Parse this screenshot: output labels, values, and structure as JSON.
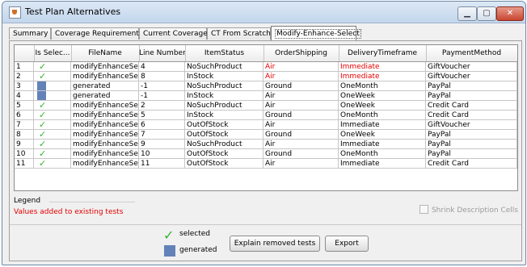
{
  "window": {
    "title": "Test Plan Alternatives",
    "controls": {
      "min": "▁",
      "max": "▢",
      "close": "✕"
    }
  },
  "tabs": [
    {
      "label": "Summary",
      "active": false
    },
    {
      "label": "Coverage Requirements",
      "active": false
    },
    {
      "label": "Current Coverage",
      "active": false
    },
    {
      "label": "CT From Scratch",
      "active": false
    },
    {
      "label": "Modify-Enhance-Select",
      "active": true
    }
  ],
  "table": {
    "columns": [
      "",
      "Is Selec...",
      "FileName",
      "Line Number",
      "ItemStatus",
      "OrderShipping",
      "DeliveryTimeframe",
      "PaymentMethod"
    ],
    "rows": [
      {
        "id": "1",
        "status": "selected",
        "file": "modifyEnhanceSe...",
        "line": "4",
        "item": "NoSuchProduct",
        "ship": "Air",
        "ship_red": true,
        "delivery": "Immediate",
        "delivery_red": true,
        "pay": "GiftVoucher",
        "pay_red": false
      },
      {
        "id": "2",
        "status": "selected",
        "file": "modifyEnhanceSe...",
        "line": "8",
        "item": "InStock",
        "ship": "Air",
        "ship_red": true,
        "delivery": "Immediate",
        "delivery_red": true,
        "pay": "GiftVoucher",
        "pay_red": false
      },
      {
        "id": "3",
        "status": "generated",
        "file": "generated",
        "line": "-1",
        "item": "NoSuchProduct",
        "ship": "Ground",
        "ship_red": false,
        "delivery": "OneMonth",
        "delivery_red": false,
        "pay": "PayPal",
        "pay_red": false
      },
      {
        "id": "4",
        "status": "generated",
        "file": "generated",
        "line": "-1",
        "item": "InStock",
        "ship": "Air",
        "ship_red": false,
        "delivery": "OneWeek",
        "delivery_red": false,
        "pay": "PayPal",
        "pay_red": false
      },
      {
        "id": "5",
        "status": "selected",
        "file": "modifyEnhanceSe...",
        "line": "2",
        "item": "NoSuchProduct",
        "ship": "Air",
        "ship_red": false,
        "delivery": "OneWeek",
        "delivery_red": false,
        "pay": "Credit Card",
        "pay_red": false
      },
      {
        "id": "6",
        "status": "selected",
        "file": "modifyEnhanceSe...",
        "line": "5",
        "item": "InStock",
        "ship": "Ground",
        "ship_red": false,
        "delivery": "OneMonth",
        "delivery_red": false,
        "pay": "Credit Card",
        "pay_red": false
      },
      {
        "id": "7",
        "status": "selected",
        "file": "modifyEnhanceSe...",
        "line": "6",
        "item": "OutOfStock",
        "ship": "Air",
        "ship_red": false,
        "delivery": "Immediate",
        "delivery_red": false,
        "pay": "GiftVoucher",
        "pay_red": false
      },
      {
        "id": "8",
        "status": "selected",
        "file": "modifyEnhanceSe...",
        "line": "7",
        "item": "OutOfStock",
        "ship": "Ground",
        "ship_red": false,
        "delivery": "OneWeek",
        "delivery_red": false,
        "pay": "PayPal",
        "pay_red": false
      },
      {
        "id": "9",
        "status": "selected",
        "file": "modifyEnhanceSe...",
        "line": "9",
        "item": "NoSuchProduct",
        "ship": "Air",
        "ship_red": false,
        "delivery": "Immediate",
        "delivery_red": false,
        "pay": "PayPal",
        "pay_red": false
      },
      {
        "id": "10",
        "status": "selected",
        "file": "modifyEnhanceSe...",
        "line": "10",
        "item": "OutOfStock",
        "ship": "Ground",
        "ship_red": false,
        "delivery": "OneMonth",
        "delivery_red": false,
        "pay": "PayPal",
        "pay_red": false
      },
      {
        "id": "11",
        "status": "selected",
        "file": "modifyEnhanceSe...",
        "line": "11",
        "item": "OutOfStock",
        "ship": "Air",
        "ship_red": false,
        "delivery": "Immediate",
        "delivery_red": false,
        "pay": "Credit Card",
        "pay_red": false
      }
    ]
  },
  "legend": {
    "title": "Legend",
    "note": "Values added to existing tests"
  },
  "shrink": {
    "label": "Shrink Description Cells",
    "checked": false
  },
  "key": {
    "selected_icon": "✓",
    "selected_label": "selected",
    "generated_label": "generated"
  },
  "buttons": {
    "explain": "Explain removed tests",
    "export": "Export"
  },
  "colors": {
    "red_text": "#e60000",
    "check_green": "#2fb52f",
    "generated_blue": "#6382b8"
  }
}
